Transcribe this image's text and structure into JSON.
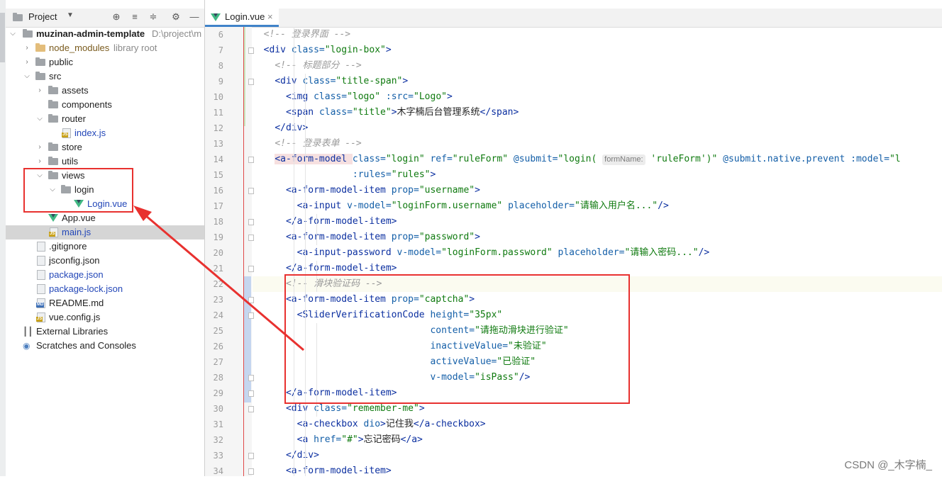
{
  "project_panel": {
    "title": "Project",
    "tree": [
      {
        "label": "muzinan-admin-template",
        "hint": "D:\\project\\m",
        "type": "root"
      },
      {
        "label": "node_modules",
        "hint": "library root",
        "type": "lib"
      },
      {
        "label": "public",
        "type": "folder"
      },
      {
        "label": "src",
        "type": "folder"
      },
      {
        "label": "assets",
        "type": "folder"
      },
      {
        "label": "components",
        "type": "folder"
      },
      {
        "label": "router",
        "type": "folder"
      },
      {
        "label": "index.js",
        "type": "js"
      },
      {
        "label": "store",
        "type": "folder"
      },
      {
        "label": "utils",
        "type": "folder"
      },
      {
        "label": "views",
        "type": "folder"
      },
      {
        "label": "login",
        "type": "folder"
      },
      {
        "label": "Login.vue",
        "type": "vue"
      },
      {
        "label": "App.vue",
        "type": "vue"
      },
      {
        "label": "main.js",
        "type": "js"
      },
      {
        "label": ".gitignore",
        "type": "file"
      },
      {
        "label": "jsconfig.json",
        "type": "json"
      },
      {
        "label": "package.json",
        "type": "json"
      },
      {
        "label": "package-lock.json",
        "type": "json"
      },
      {
        "label": "README.md",
        "type": "md"
      },
      {
        "label": "vue.config.js",
        "type": "js"
      },
      {
        "label": "External Libraries",
        "type": "ext"
      },
      {
        "label": "Scratches and Consoles",
        "type": "scratch"
      }
    ]
  },
  "editor": {
    "tab_label": "Login.vue",
    "close_glyph": "×",
    "line_numbers": [
      "6",
      "7",
      "8",
      "9",
      "10",
      "11",
      "12",
      "13",
      "14",
      "15",
      "16",
      "17",
      "18",
      "19",
      "20",
      "21",
      "22",
      "23",
      "24",
      "25",
      "26",
      "27",
      "28",
      "29",
      "30",
      "31",
      "32",
      "33",
      "34"
    ],
    "lines": [
      {
        "indent": "  ",
        "parts": [
          [
            "c",
            "<!-- 登录界面 -->"
          ]
        ]
      },
      {
        "indent": "  ",
        "parts": [
          [
            "t",
            "<div "
          ],
          [
            "a",
            "class="
          ],
          [
            "s",
            "\"login-box\""
          ],
          [
            "t",
            ">"
          ]
        ]
      },
      {
        "indent": "    ",
        "parts": [
          [
            "c",
            "<!-- 标题部分 -->"
          ]
        ]
      },
      {
        "indent": "    ",
        "parts": [
          [
            "t",
            "<div "
          ],
          [
            "a",
            "class="
          ],
          [
            "s",
            "\"title-span\""
          ],
          [
            "t",
            ">"
          ]
        ]
      },
      {
        "indent": "      ",
        "parts": [
          [
            "t",
            "<img "
          ],
          [
            "a",
            "class="
          ],
          [
            "s",
            "\"logo\" "
          ],
          [
            "a",
            ":src="
          ],
          [
            "s",
            "\"Logo\""
          ],
          [
            "t",
            ">"
          ]
        ]
      },
      {
        "indent": "      ",
        "parts": [
          [
            "t",
            "<span "
          ],
          [
            "a",
            "class="
          ],
          [
            "s",
            "\"title\""
          ],
          [
            "t",
            ">"
          ],
          [
            "x",
            "木字楠后台管理系统"
          ],
          [
            "t",
            "</span>"
          ]
        ]
      },
      {
        "indent": "    ",
        "parts": [
          [
            "t",
            "</div>"
          ]
        ]
      },
      {
        "indent": "    ",
        "parts": [
          [
            "c",
            "<!-- 登录表单 -->"
          ]
        ]
      },
      {
        "indent": "    ",
        "parts": [
          [
            "tr",
            "<a-form-model "
          ],
          [
            "a",
            "class="
          ],
          [
            "s",
            "\"login\" "
          ],
          [
            "a",
            "ref="
          ],
          [
            "s",
            "\"ruleForm\" "
          ],
          [
            "a",
            "@submit="
          ],
          [
            "s",
            "\"login( "
          ],
          [
            "h",
            "formName:"
          ],
          [
            "s",
            " 'ruleForm')\" "
          ],
          [
            "a",
            "@submit.native.prevent :model="
          ],
          [
            "s",
            "\"l"
          ]
        ]
      },
      {
        "indent": "                  ",
        "parts": [
          [
            "a",
            ":rules="
          ],
          [
            "s",
            "\"rules\""
          ],
          [
            "t",
            ">"
          ]
        ]
      },
      {
        "indent": "      ",
        "parts": [
          [
            "t",
            "<a-form-model-item "
          ],
          [
            "a",
            "prop="
          ],
          [
            "s",
            "\"username\""
          ],
          [
            "t",
            ">"
          ]
        ]
      },
      {
        "indent": "        ",
        "parts": [
          [
            "t",
            "<a-input "
          ],
          [
            "a",
            "v-model="
          ],
          [
            "s",
            "\"loginForm.username\" "
          ],
          [
            "a",
            "placeholder="
          ],
          [
            "s",
            "\"请输入用户名...\""
          ],
          [
            "t",
            "/>"
          ]
        ]
      },
      {
        "indent": "      ",
        "parts": [
          [
            "t",
            "</a-form-model-item>"
          ]
        ]
      },
      {
        "indent": "      ",
        "parts": [
          [
            "t",
            "<a-form-model-item "
          ],
          [
            "a",
            "prop="
          ],
          [
            "s",
            "\"password\""
          ],
          [
            "t",
            ">"
          ]
        ]
      },
      {
        "indent": "        ",
        "parts": [
          [
            "t",
            "<a-input-password "
          ],
          [
            "a",
            "v-model="
          ],
          [
            "s",
            "\"loginForm.password\" "
          ],
          [
            "a",
            "placeholder="
          ],
          [
            "s",
            "\"请输入密码...\""
          ],
          [
            "t",
            "/>"
          ]
        ]
      },
      {
        "indent": "      ",
        "parts": [
          [
            "t",
            "</a-form-model-item>"
          ]
        ]
      },
      {
        "indent": "      ",
        "parts": [
          [
            "c",
            "<!-- 滑块验证码 -->"
          ]
        ]
      },
      {
        "indent": "      ",
        "parts": [
          [
            "t",
            "<a-form-model-item "
          ],
          [
            "a",
            "prop="
          ],
          [
            "s",
            "\"captcha\""
          ],
          [
            "t",
            ">"
          ]
        ]
      },
      {
        "indent": "        ",
        "parts": [
          [
            "t",
            "<SliderVerificationCode "
          ],
          [
            "a",
            "height="
          ],
          [
            "s",
            "\"35px\""
          ]
        ]
      },
      {
        "indent": "                                ",
        "parts": [
          [
            "a",
            "content="
          ],
          [
            "s",
            "\"请拖动滑块进行验证\""
          ]
        ]
      },
      {
        "indent": "                                ",
        "parts": [
          [
            "a",
            "inactiveValue="
          ],
          [
            "s",
            "\"未验证\""
          ]
        ]
      },
      {
        "indent": "                                ",
        "parts": [
          [
            "a",
            "activeValue="
          ],
          [
            "s",
            "\"已验证\""
          ]
        ]
      },
      {
        "indent": "                                ",
        "parts": [
          [
            "a",
            "v-model="
          ],
          [
            "s",
            "\"isPass\""
          ],
          [
            "t",
            "/>"
          ]
        ]
      },
      {
        "indent": "      ",
        "parts": [
          [
            "t",
            "</a-form-model-item>"
          ]
        ]
      },
      {
        "indent": "      ",
        "parts": [
          [
            "t",
            "<div "
          ],
          [
            "a",
            "class="
          ],
          [
            "s",
            "\"remember-me\""
          ],
          [
            "t",
            ">"
          ]
        ]
      },
      {
        "indent": "        ",
        "parts": [
          [
            "t",
            "<a-checkbox "
          ],
          [
            "a",
            "dio"
          ],
          [
            "t",
            ">"
          ],
          [
            "x",
            "记住我"
          ],
          [
            "t",
            "</a-checkbox>"
          ]
        ]
      },
      {
        "indent": "        ",
        "parts": [
          [
            "t",
            "<a "
          ],
          [
            "a",
            "href="
          ],
          [
            "s",
            "\"#\""
          ],
          [
            "t",
            ">"
          ],
          [
            "x",
            "忘记密码"
          ],
          [
            "t",
            "</a>"
          ]
        ]
      },
      {
        "indent": "      ",
        "parts": [
          [
            "t",
            "</div>"
          ]
        ]
      },
      {
        "indent": "      ",
        "parts": [
          [
            "t",
            "<a-form-model-item>"
          ]
        ]
      }
    ]
  },
  "watermark": "CSDN @_木字楠_",
  "colors": {
    "annotation": "#e8312f",
    "tag": "#0b2fa0",
    "attr": "#145fa8",
    "string": "#0f7a0f",
    "comment": "#9a9a9a"
  }
}
